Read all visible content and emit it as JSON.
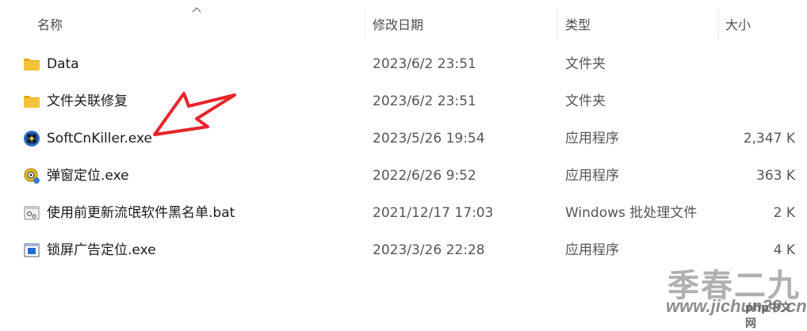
{
  "columns": {
    "name": "名称",
    "modified": "修改日期",
    "type": "类型",
    "size": "大小"
  },
  "files": [
    {
      "name": "Data",
      "modified": "2023/6/2 23:51",
      "type": "文件夹",
      "size": "",
      "icon": "folder-icon"
    },
    {
      "name": "文件关联修复",
      "modified": "2023/6/2 23:51",
      "type": "文件夹",
      "size": "",
      "icon": "folder-icon"
    },
    {
      "name": "SoftCnKiller.exe",
      "modified": "2023/5/26 19:54",
      "type": "应用程序",
      "size": "2,347 K",
      "icon": "softcnkiller-app-icon"
    },
    {
      "name": "弹窗定位.exe",
      "modified": "2022/6/26 9:52",
      "type": "应用程序",
      "size": "363 K",
      "icon": "target-app-icon"
    },
    {
      "name": "使用前更新流氓软件黑名单.bat",
      "modified": "2021/12/17 17:03",
      "type": "Windows 批处理文件",
      "size": "2 K",
      "icon": "batch-file-icon"
    },
    {
      "name": "锁屏广告定位.exe",
      "modified": "2023/3/26 22:28",
      "type": "应用程序",
      "size": "4 K",
      "icon": "window-app-icon"
    }
  ],
  "watermark": {
    "title": "季春二九",
    "url": "www.jichun29.cn",
    "logo": "php中文网"
  },
  "colors": {
    "arrow": "#e8252b",
    "folder": "#f4c13a",
    "header_text": "#4d4d4d"
  }
}
